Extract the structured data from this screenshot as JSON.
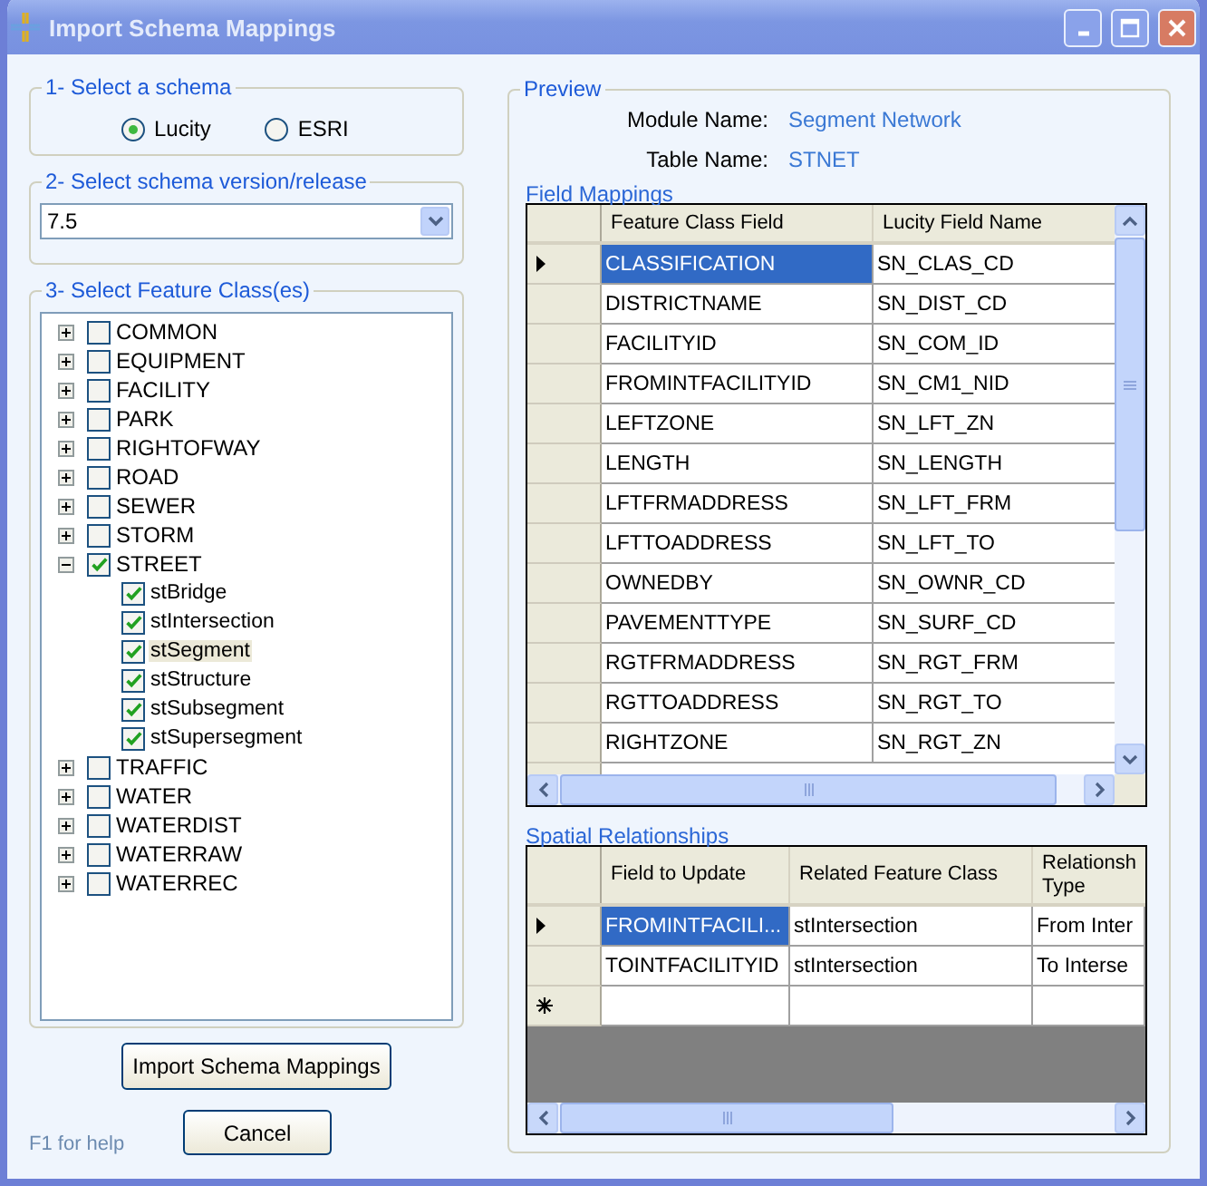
{
  "window": {
    "title": "Import Schema Mappings"
  },
  "schema_group": {
    "title": "1- Select a schema",
    "options": [
      {
        "label": "Lucity",
        "selected": true
      },
      {
        "label": "ESRI",
        "selected": false
      }
    ]
  },
  "version_group": {
    "title": "2- Select schema version/release",
    "value": "7.5"
  },
  "feature_group": {
    "title": "3- Select Feature Class(es)",
    "tree": [
      {
        "label": "COMMON",
        "checked": false,
        "expanded": false,
        "selected": false
      },
      {
        "label": "EQUIPMENT",
        "checked": false,
        "expanded": false,
        "selected": false
      },
      {
        "label": "FACILITY",
        "checked": false,
        "expanded": false,
        "selected": false
      },
      {
        "label": "PARK",
        "checked": false,
        "expanded": false,
        "selected": false
      },
      {
        "label": "RIGHTOFWAY",
        "checked": false,
        "expanded": false,
        "selected": false
      },
      {
        "label": "ROAD",
        "checked": false,
        "expanded": false,
        "selected": false
      },
      {
        "label": "SEWER",
        "checked": false,
        "expanded": false,
        "selected": false
      },
      {
        "label": "STORM",
        "checked": false,
        "expanded": false,
        "selected": false
      },
      {
        "label": "STREET",
        "checked": true,
        "expanded": true,
        "selected": false,
        "children": [
          {
            "label": "stBridge",
            "checked": true,
            "selected": false
          },
          {
            "label": "stIntersection",
            "checked": true,
            "selected": false
          },
          {
            "label": "stSegment",
            "checked": true,
            "selected": true
          },
          {
            "label": "stStructure",
            "checked": true,
            "selected": false
          },
          {
            "label": "stSubsegment",
            "checked": true,
            "selected": false
          },
          {
            "label": "stSupersegment",
            "checked": true,
            "selected": false
          }
        ]
      },
      {
        "label": "TRAFFIC",
        "checked": false,
        "expanded": false,
        "selected": false
      },
      {
        "label": "WATER",
        "checked": false,
        "expanded": false,
        "selected": false
      },
      {
        "label": "WATERDIST",
        "checked": false,
        "expanded": false,
        "selected": false
      },
      {
        "label": "WATERRAW",
        "checked": false,
        "expanded": false,
        "selected": false
      },
      {
        "label": "WATERREC",
        "checked": false,
        "expanded": false,
        "selected": false
      }
    ]
  },
  "buttons": [
    {
      "label": "Import Schema Mappings"
    },
    {
      "label": "Cancel"
    }
  ],
  "help_text": "F1 for help",
  "preview": {
    "title": "Preview",
    "fields": [
      {
        "label": "Module Name:",
        "value": "Segment Network"
      },
      {
        "label": "Table Name:",
        "value": "STNET"
      }
    ],
    "field_mappings": {
      "title": "Field Mappings",
      "columns": [
        "Feature Class Field",
        "Lucity Field Name"
      ],
      "rows": [
        {
          "cells": [
            "CLASSIFICATION",
            "SN_CLAS_CD"
          ],
          "selected": true
        },
        {
          "cells": [
            "DISTRICTNAME",
            "SN_DIST_CD"
          ],
          "selected": false
        },
        {
          "cells": [
            "FACILITYID",
            "SN_COM_ID"
          ],
          "selected": false
        },
        {
          "cells": [
            "FROMINTFACILITYID",
            "SN_CM1_NID"
          ],
          "selected": false
        },
        {
          "cells": [
            "LEFTZONE",
            "SN_LFT_ZN"
          ],
          "selected": false
        },
        {
          "cells": [
            "LENGTH",
            "SN_LENGTH"
          ],
          "selected": false
        },
        {
          "cells": [
            "LFTFRMADDRESS",
            "SN_LFT_FRM"
          ],
          "selected": false
        },
        {
          "cells": [
            "LFTTOADDRESS",
            "SN_LFT_TO"
          ],
          "selected": false
        },
        {
          "cells": [
            "OWNEDBY",
            "SN_OWNR_CD"
          ],
          "selected": false
        },
        {
          "cells": [
            "PAVEMENTTYPE",
            "SN_SURF_CD"
          ],
          "selected": false
        },
        {
          "cells": [
            "RGTFRMADDRESS",
            "SN_RGT_FRM"
          ],
          "selected": false
        },
        {
          "cells": [
            "RGTTOADDRESS",
            "SN_RGT_TO"
          ],
          "selected": false
        },
        {
          "cells": [
            "RIGHTZONE",
            "SN_RGT_ZN"
          ],
          "selected": false
        }
      ]
    },
    "spatial_relationships": {
      "title": "Spatial Relationships",
      "columns": [
        "Field to Update",
        "Related Feature Class",
        "Relationsh Type"
      ],
      "rows": [
        {
          "cells": [
            "FROMINTFACILI...",
            "stIntersection",
            "From Inter"
          ],
          "selected": true
        },
        {
          "cells": [
            "TOINTFACILITYID",
            "stIntersection",
            "To Interse"
          ],
          "selected": false
        }
      ]
    }
  }
}
